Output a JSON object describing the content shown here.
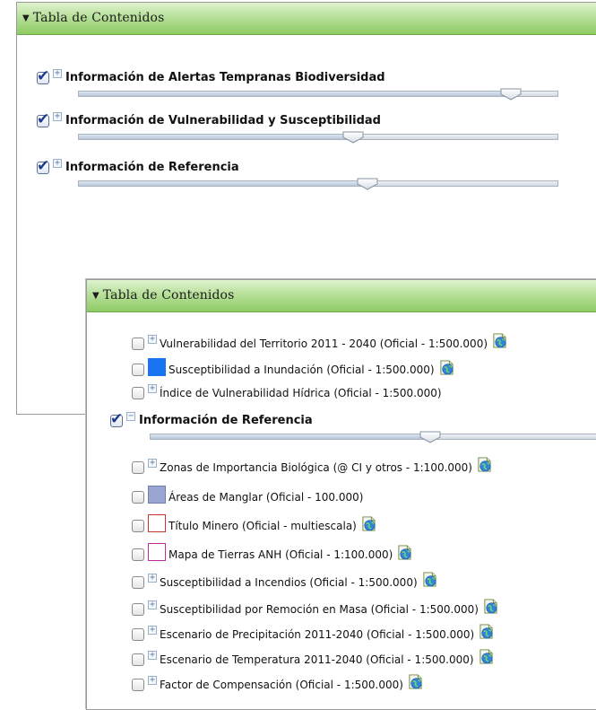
{
  "back_panel": {
    "header": "Tabla de Contenidos",
    "groups": [
      {
        "label": "Información de Alertas Tempranas Biodiversidad",
        "checked": true,
        "opacity": 0.9
      },
      {
        "label": "Información de Vulnerabilidad y Susceptibilidad",
        "checked": true,
        "opacity": 0.57
      },
      {
        "label": "Información de Referencia",
        "checked": true,
        "opacity": 0.6
      }
    ]
  },
  "front_panel": {
    "header": "Tabla de Contenidos",
    "layers_top": [
      {
        "label": "Vulnerabilidad del Territorio 2011 - 2040 (Oficial - 1:500.000)",
        "symbol": "expand",
        "has_link": true
      },
      {
        "label": "Susceptibilidad a Inundación (Oficial - 1:500.000)",
        "symbol": "swatch",
        "swatch_fill": "#1a73f0",
        "swatch_border": "#1a73f0",
        "has_link": true
      },
      {
        "label": "Índice de Vulnerabilidad Hídrica (Oficial - 1:500.000)",
        "symbol": "expand",
        "has_link": false
      }
    ],
    "group": {
      "label": "Información de Referencia",
      "checked": true,
      "opacity": 0.6
    },
    "layers_bottom": [
      {
        "label": "Zonas de Importancia Biológica (@ CI y otros - 1:100.000)",
        "symbol": "expand",
        "has_link": true
      },
      {
        "label": "Áreas de Manglar (Oficial - 100.000)",
        "symbol": "swatch",
        "swatch_fill": "#9aa6cf",
        "swatch_border": "#6f7db3",
        "has_link": false
      },
      {
        "label": "Título Minero (Oficial - multiescala)",
        "symbol": "swatch",
        "swatch_fill": "#ffffff",
        "swatch_border": "#c0392b",
        "has_link": true
      },
      {
        "label": "Mapa de Tierras ANH (Oficial - 1:100.000)",
        "symbol": "swatch",
        "swatch_fill": "#ffffff",
        "swatch_border": "#c02ba0",
        "has_link": true
      },
      {
        "label": "Susceptibilidad a Incendios (Oficial - 1:500.000)",
        "symbol": "expand",
        "has_link": true
      },
      {
        "label": "Susceptibilidad por Remoción en Masa (Oficial - 1:500.000)",
        "symbol": "expand",
        "has_link": true
      },
      {
        "label": "Escenario de Precipitación 2011-2040 (Oficial - 1:500.000)",
        "symbol": "expand",
        "has_link": true
      },
      {
        "label": "Escenario de Temperatura 2011-2040 (Oficial - 1:500.000)",
        "symbol": "expand",
        "has_link": true
      },
      {
        "label": "Factor de Compensación (Oficial - 1:500.000)",
        "symbol": "expand",
        "has_link": true
      }
    ]
  },
  "icons": {
    "collapse_arrow": "triangle-down-icon",
    "expand": "plus-box-icon",
    "collapse": "minus-box-icon",
    "checkbox": "checkbox-icon",
    "layer_link": "globe-document-icon"
  },
  "colors": {
    "header_green": "#8fcb63",
    "checkmark_blue": "#1e3d8f"
  }
}
